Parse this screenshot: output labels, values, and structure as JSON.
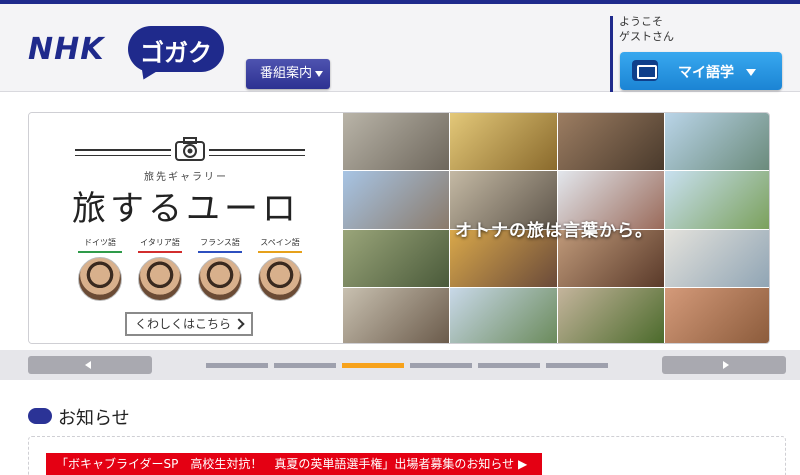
{
  "header": {
    "logo_nhk": "NHK",
    "logo_gogaku": "ゴガク",
    "program_menu_label": "番組案内",
    "welcome_line1": "ようこそ",
    "welcome_line2": "ゲストさん",
    "my_gogaku_label": "マイ語学"
  },
  "banner": {
    "subtitle": "旅先ギャラリー",
    "title": "旅するユーロ",
    "languages": [
      {
        "label": "ドイツ語",
        "color": "#2f9b4a"
      },
      {
        "label": "イタリア語",
        "color": "#d22d2d"
      },
      {
        "label": "フランス語",
        "color": "#2d4fbf"
      },
      {
        "label": "スペイン語",
        "color": "#e6a11b"
      }
    ],
    "more_label": "くわしくはこちら",
    "tagline": "オトナの旅は言葉から。"
  },
  "carousel": {
    "slide_count": 6,
    "active_index": 2
  },
  "news": {
    "heading": "お知らせ",
    "items": [
      {
        "text": "「ボキャブライダーSP　高校生対抗！　真夏の英単語選手権」出場者募集のお知らせ ▶"
      }
    ]
  },
  "colors": {
    "brand_navy": "#1f2a8c",
    "my_gogaku_blue": "#2196e3",
    "carousel_active": "#f7a21b",
    "news_red": "#e40013"
  }
}
